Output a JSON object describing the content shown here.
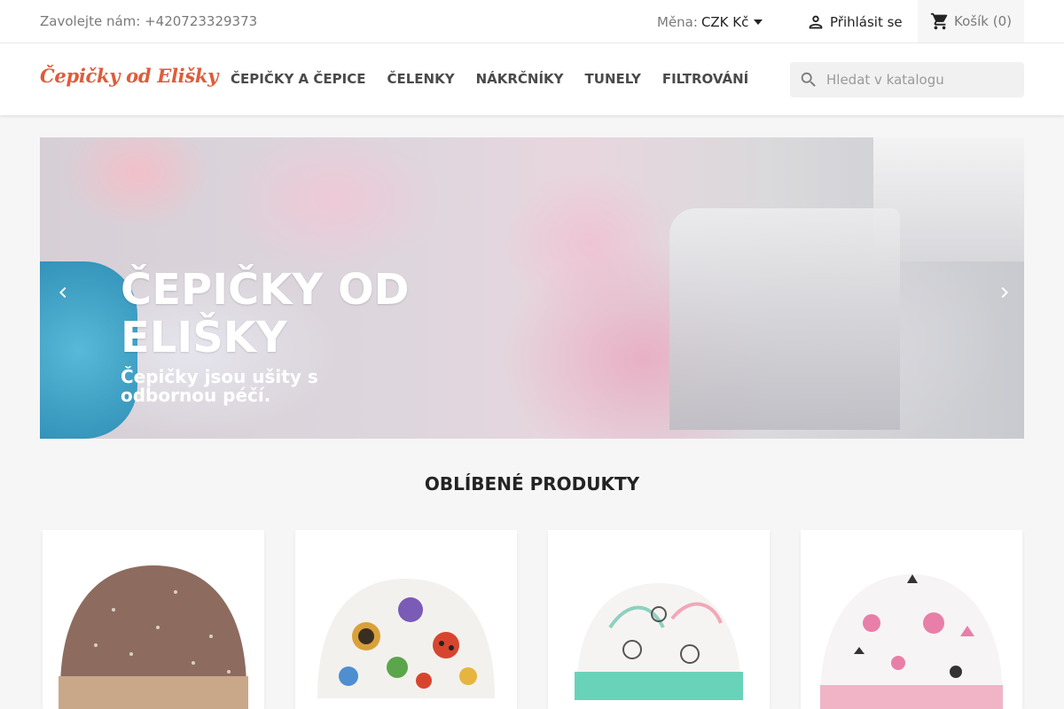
{
  "topbar": {
    "contact": "Zavolejte nám: +420723329373",
    "currency_label": "Měna:",
    "currency_value": "CZK Kč",
    "login": "Přihlásit se",
    "cart": "Košík (0)"
  },
  "header": {
    "logo": "Čepičky od Elišky",
    "nav": [
      "ČEPIČKY A ČEPICE",
      "ČELENKY",
      "NÁKRČNÍKY",
      "TUNELY",
      "FILTROVÁNÍ"
    ],
    "search_placeholder": "Hledat v katalogu"
  },
  "hero": {
    "title": "ČEPIČKY OD ELIŠKY",
    "subtitle": "Čepičky jsou ušity s odbornou péčí."
  },
  "section": {
    "title": "OBLÍBENÉ PRODUKTY"
  },
  "colors": {
    "accent": "#e05b3a",
    "background": "#f6f6f6"
  }
}
